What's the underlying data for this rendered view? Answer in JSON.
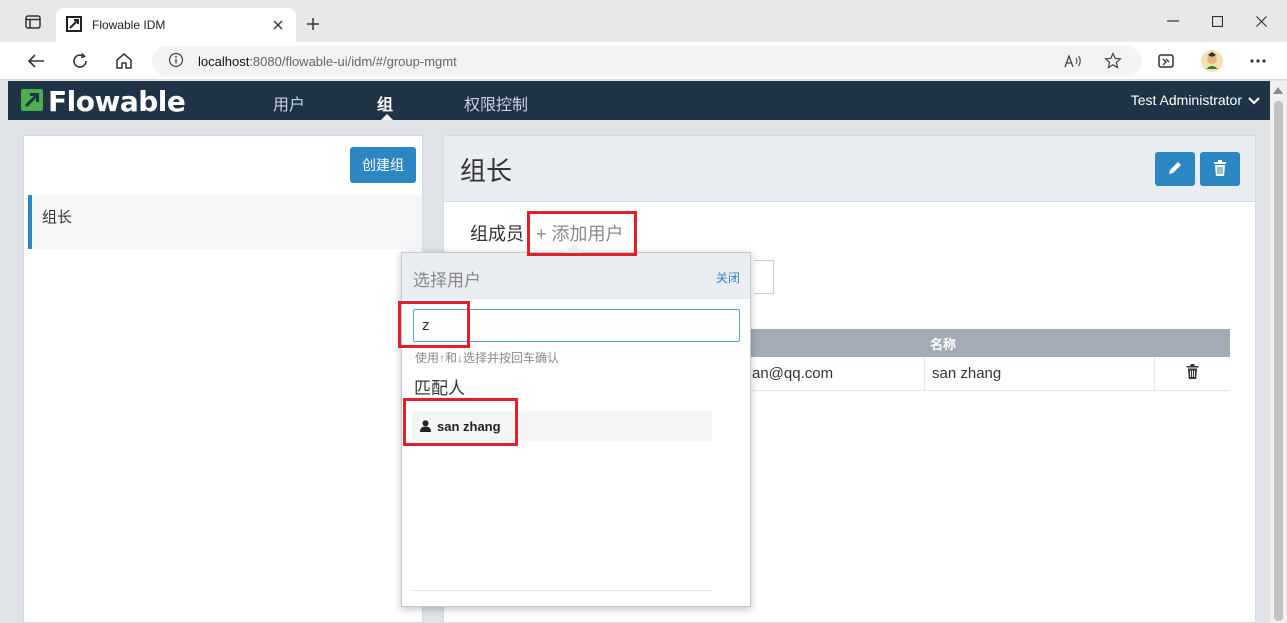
{
  "browser": {
    "tab_title": "Flowable IDM",
    "url_host": "localhost",
    "url_path": ":8080/flowable-ui/idm/#/group-mgmt"
  },
  "app": {
    "logo_text": "Flowable",
    "nav": [
      {
        "label": "用户"
      },
      {
        "label": "组"
      },
      {
        "label": "权限控制"
      }
    ],
    "user_menu": "Test Administrator"
  },
  "left": {
    "create_button": "创建组",
    "groups": [
      {
        "name": "组长"
      }
    ]
  },
  "right": {
    "title": "组长",
    "members_label": "组成员",
    "add_user_label": "+ 添加用户",
    "table": {
      "headers": [
        "",
        "名称",
        ""
      ],
      "rows": [
        {
          "email_fragment": "an@qq.com",
          "name": "san zhang"
        }
      ]
    }
  },
  "popup": {
    "title": "选择用户",
    "close_label": "关闭",
    "search_value": "z",
    "hint": "使用↑和↓选择并按回车确认",
    "match_label": "匹配人",
    "results": [
      {
        "name": "san zhang"
      }
    ]
  },
  "colors": {
    "navbar": "#1f3347",
    "accent": "#2c86c2",
    "highlight": "#e2202a"
  }
}
